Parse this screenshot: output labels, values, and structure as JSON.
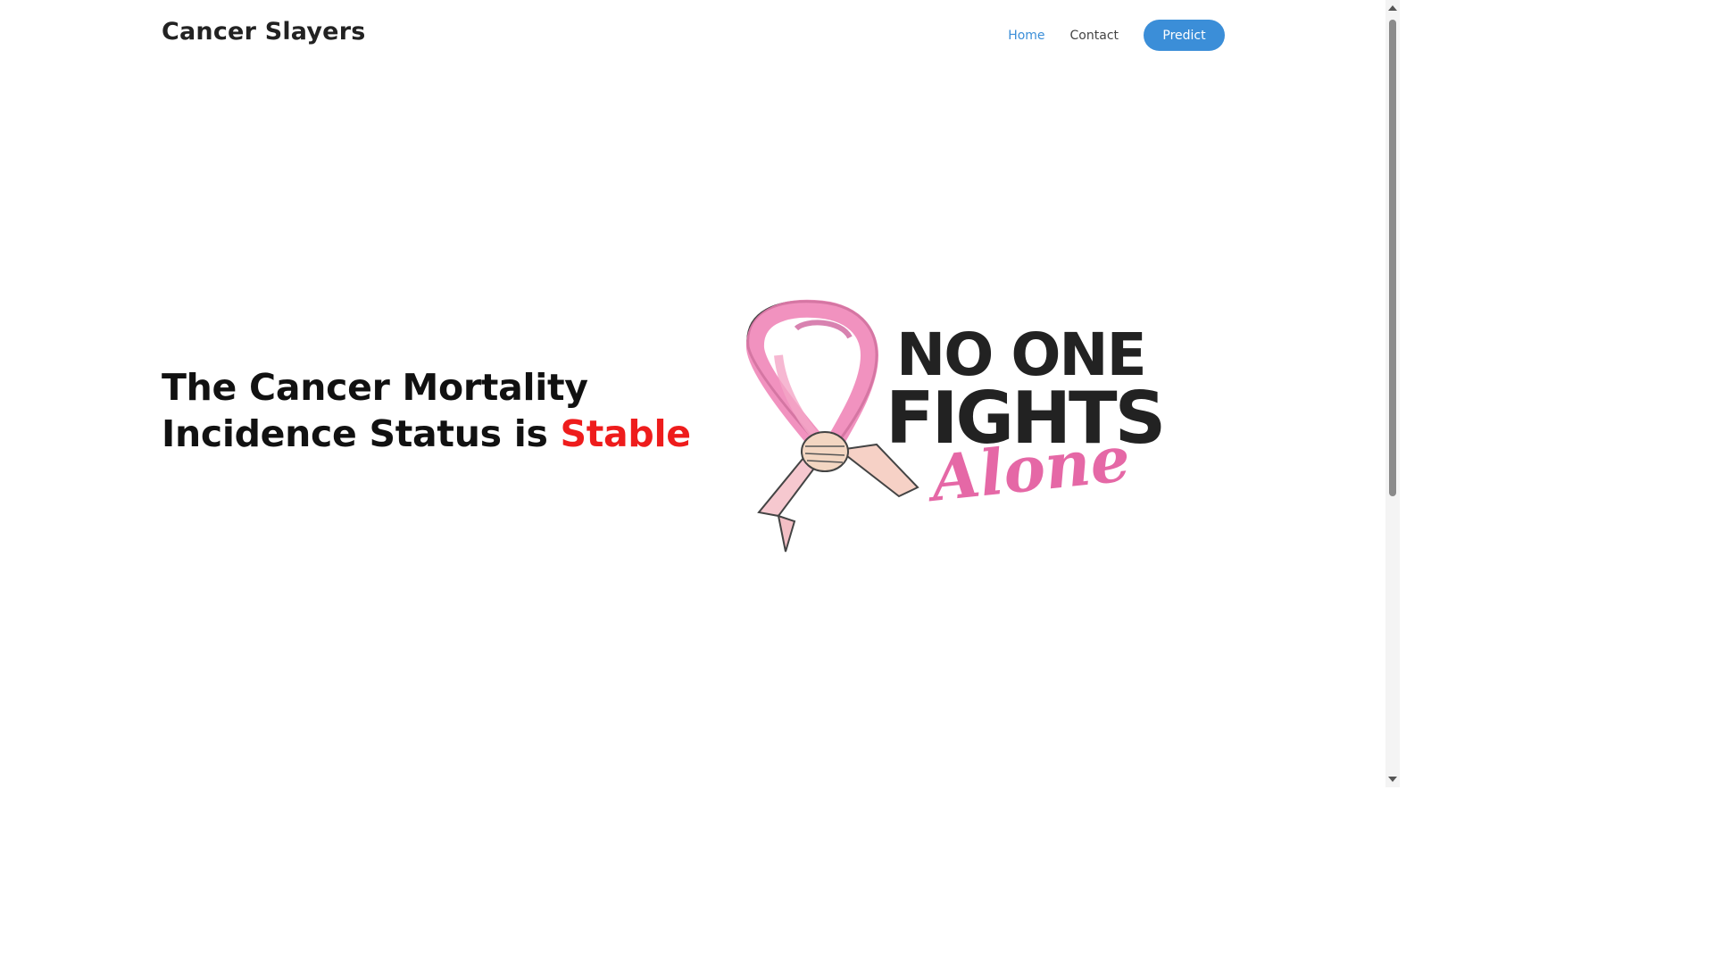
{
  "header": {
    "brand": "Cancer Slayers",
    "nav": {
      "home": "Home",
      "contact": "Contact",
      "predict": "Predict"
    }
  },
  "hero": {
    "line1": "The Cancer Mortality",
    "line2_prefix": "Incidence Status is ",
    "status": "Stable",
    "status_color": "#ee1c1c"
  },
  "logo": {
    "line1": "NO ONE",
    "line2": "FIGHTS",
    "line3": "Alone",
    "icon": "pink-ribbon-icon"
  },
  "colors": {
    "accent": "#3b8ed8",
    "ribbon_pink": "#ee7fb4"
  }
}
